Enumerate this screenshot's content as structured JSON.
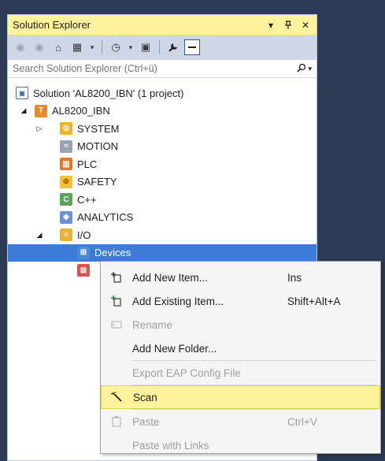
{
  "panel": {
    "title": "Solution Explorer",
    "title_buttons": {
      "dropdown": "▾",
      "pin": "⊥",
      "close": "✕"
    }
  },
  "toolbar": {
    "icons": [
      "back-icon",
      "forward-icon",
      "home-icon",
      "switch-views-icon",
      "dropdown-icon",
      "pending-changes-icon",
      "dropdown-icon",
      "collapse-all-icon",
      "properties-wrench-icon",
      "preview-icon"
    ]
  },
  "search": {
    "placeholder": "Search Solution Explorer (Ctrl+ü)",
    "icon": "search-icon"
  },
  "tree": {
    "solution": "Solution 'AL8200_IBN' (1 project)",
    "project": "AL8200_IBN",
    "system": "SYSTEM",
    "motion": "MOTION",
    "plc": "PLC",
    "safety": "SAFETY",
    "cpp": "C++",
    "analytics": "ANALYTICS",
    "io": "I/O",
    "devices": "Devices"
  },
  "context_menu": {
    "items": [
      {
        "label": "Add New Item...",
        "shortcut": "Ins",
        "enabled": true
      },
      {
        "label": "Add Existing Item...",
        "shortcut": "Shift+Alt+A",
        "enabled": true
      },
      {
        "label": "Rename",
        "shortcut": "",
        "enabled": false
      },
      {
        "label": "Add New Folder...",
        "shortcut": "",
        "enabled": true
      },
      {
        "label": "Export EAP Config File",
        "shortcut": "",
        "enabled": false
      },
      {
        "label": "Scan",
        "shortcut": "",
        "enabled": true,
        "highlighted": true
      },
      {
        "label": "Paste",
        "shortcut": "Ctrl+V",
        "enabled": false
      },
      {
        "label": "Paste with Links",
        "shortcut": "",
        "enabled": false
      }
    ]
  },
  "colors": {
    "title_bar": "#fff29d",
    "selection": "#3d7bd9",
    "menu_highlight": "#fff29d",
    "background": "#2b3a55"
  }
}
